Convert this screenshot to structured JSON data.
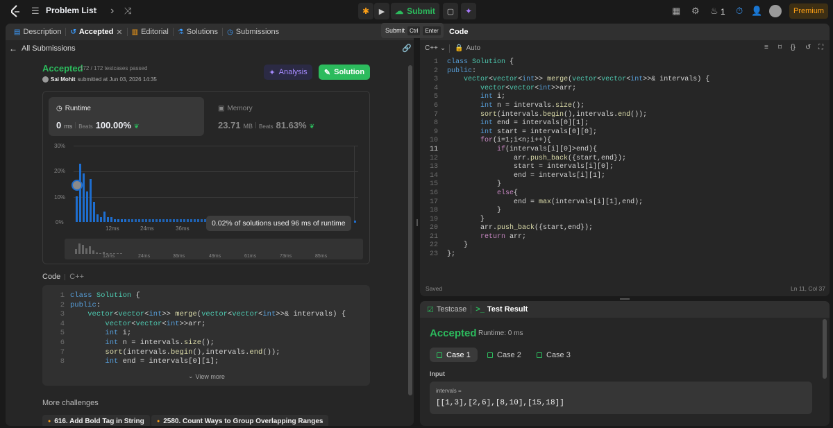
{
  "topbar": {
    "problem_list": "Problem List",
    "submit": "Submit",
    "streak": "1",
    "premium": "Premium",
    "tooltip_label": "Submit",
    "tooltip_key1": "Ctrl",
    "tooltip_key2": "Enter"
  },
  "left_tabs": [
    {
      "label": "Description",
      "icon": "description-icon"
    },
    {
      "label": "Accepted",
      "icon": "history-icon"
    },
    {
      "label": "Editorial",
      "icon": "book-icon"
    },
    {
      "label": "Solutions",
      "icon": "flask-icon"
    },
    {
      "label": "Submissions",
      "icon": "clock-icon"
    }
  ],
  "submission": {
    "back_label": "All Submissions",
    "status": "Accepted",
    "testcases": "172 / 172 testcases passed",
    "user": "Sai Mohit",
    "submitted_text": "submitted at Jun 03, 2026 14:35",
    "analysis_button": "Analysis",
    "solution_button": "Solution",
    "runtime_title": "Runtime",
    "runtime_value": "0",
    "runtime_unit": "ms",
    "beats_label": "Beats",
    "runtime_beats": "100.00%",
    "memory_title": "Memory",
    "memory_value": "23.71",
    "memory_unit": "MB",
    "memory_beats": "81.63%"
  },
  "chart_data": {
    "type": "bar",
    "y_ticks": [
      "30%",
      "20%",
      "10%",
      "0%"
    ],
    "x_ticks": [
      "12ms",
      "24ms",
      "36ms"
    ],
    "ylim": [
      0,
      30
    ],
    "values": [
      10,
      23,
      19,
      12,
      17,
      8,
      3,
      2,
      4,
      2,
      2,
      1,
      1,
      1,
      1,
      1,
      1,
      1,
      1,
      1,
      1,
      1,
      1,
      1,
      1,
      1,
      1,
      1,
      1,
      1,
      1,
      1,
      1,
      1,
      1,
      1,
      1,
      1,
      1,
      1
    ],
    "tooltip": "0.02% of solutions used 96 ms of runtime",
    "overview_ticks": [
      "12ms",
      "24ms",
      "36ms",
      "49ms",
      "61ms",
      "73ms",
      "85ms"
    ]
  },
  "code_section": {
    "title": "Code",
    "language": "C++",
    "view_more": "View more",
    "lines": [
      "class Solution {",
      "public:",
      "    vector<vector<int>> merge(vector<vector<int>>& intervals) {",
      "        vector<vector<int>>arr;",
      "        int i;",
      "        int n = intervals.size();",
      "        sort(intervals.begin(),intervals.end());",
      "        int end = intervals[0][1];"
    ]
  },
  "more_challenges": {
    "title": "More challenges",
    "items": [
      "616. Add Bold Tag in String",
      "2580. Count Ways to Group Overlapping Ranges"
    ]
  },
  "editor": {
    "language": "C++",
    "mode": "Auto",
    "saved": "Saved",
    "cursor": "Ln 11, Col 37",
    "tab_title": "Code",
    "lines": [
      "class Solution {",
      "public:",
      "    vector<vector<int>> merge(vector<vector<int>>& intervals) {",
      "        vector<vector<int>>arr;",
      "        int i;",
      "        int n = intervals.size();",
      "        sort(intervals.begin(),intervals.end());",
      "        int end = intervals[0][1];",
      "        int start = intervals[0][0];",
      "        for(i=1;i<n;i++){",
      "            if(intervals[i][0]>end){",
      "                arr.push_back({start,end});",
      "                start = intervals[i][0];",
      "                end = intervals[i][1];",
      "            }",
      "            else{",
      "                end = max(intervals[i][1],end);",
      "            }",
      "        }",
      "        arr.push_back({start,end});",
      "        return arr;",
      "    }",
      "};"
    ]
  },
  "result": {
    "tab_testcase": "Testcase",
    "tab_result": "Test Result",
    "status": "Accepted",
    "runtime": "Runtime: 0 ms",
    "cases": [
      "Case 1",
      "Case 2",
      "Case 3"
    ],
    "input_label": "Input",
    "param_name": "intervals =",
    "param_value": "[[1,3],[2,6],[8,10],[15,18]]"
  },
  "colors": {
    "accent": "#2cbb5d",
    "premium": "#ffa116",
    "bar": "#1e6ecf"
  }
}
